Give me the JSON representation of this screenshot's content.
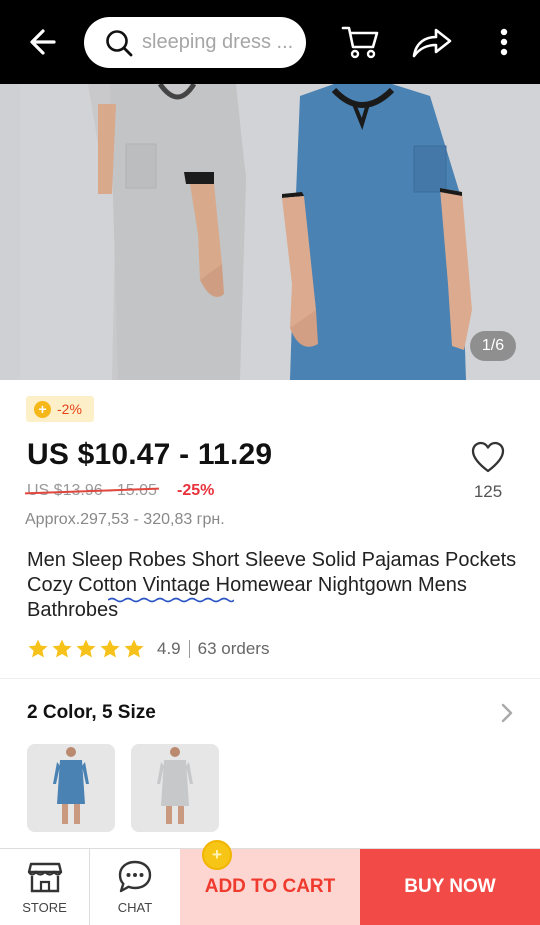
{
  "search": {
    "placeholder": "sleeping dress ..."
  },
  "gallery": {
    "counter": "1/6"
  },
  "coins_badge": {
    "text": "-2%"
  },
  "price": {
    "current": "US $10.47 - 11.29",
    "original": "US $13.96 - 15.05",
    "discount": "-25%",
    "approx": "Approx.297,53 - 320,83 грн."
  },
  "wishlist": {
    "count": "125"
  },
  "product": {
    "title": "Men Sleep Robes Short Sleeve Solid Pajamas Pockets Cozy Cotton Vintage Homewear Nightgown Mens Bathrobes"
  },
  "rating": {
    "value": "4.9",
    "orders": "63 orders",
    "stars": 5
  },
  "variants": {
    "label": "2 Color, 5 Size"
  },
  "bottom": {
    "store": "STORE",
    "chat": "CHAT",
    "add_to_cart": "ADD TO CART",
    "buy_now": "BUY NOW"
  },
  "colors": {
    "accent": "#f24a46",
    "cart_bg": "#fdd6d2",
    "price_red": "#e8323c",
    "star": "#f6c21a"
  }
}
